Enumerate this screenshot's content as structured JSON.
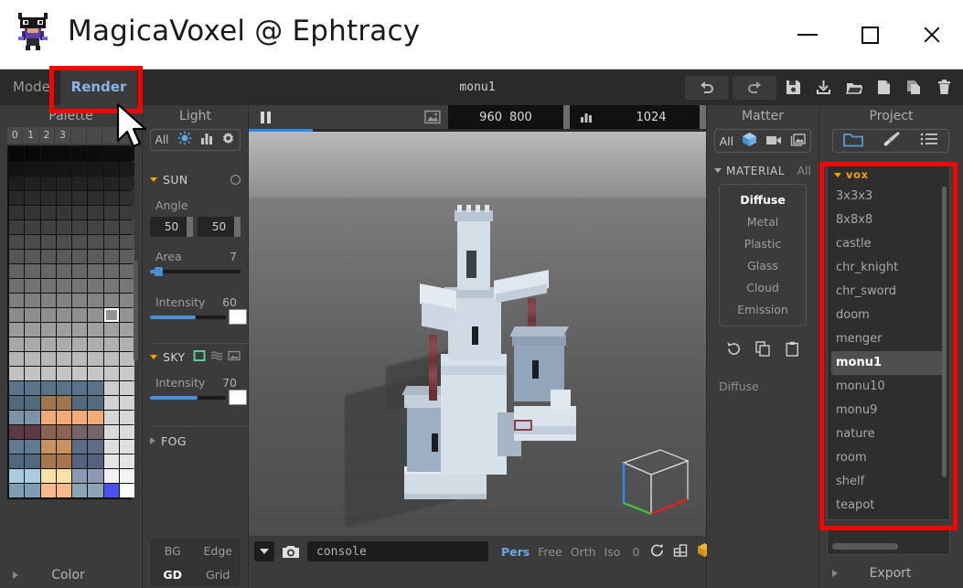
{
  "window": {
    "title": "MagicaVoxel @ Ephtracy",
    "app_icon": "bat-character-icon",
    "controls": {
      "minimize": "minimize-icon",
      "maximize": "maximize-icon",
      "close": "close-icon"
    }
  },
  "menubar": {
    "mode_label": "Mode",
    "render_label": "Render",
    "document_title": "monu1",
    "tools": [
      "undo-icon",
      "redo-icon",
      "save-icon",
      "import-icon",
      "open-folder-icon",
      "new-file-icon",
      "copy-icon",
      "trash-icon"
    ]
  },
  "palette": {
    "title": "Palette",
    "columns": [
      "0",
      "1",
      "2",
      "3"
    ],
    "color_label": "Color",
    "selected_index": 94,
    "swatches": [
      "#070707",
      "#080808",
      "#090909",
      "#0a0a0a",
      "#0b0b0b",
      "#0c0c0c",
      "#0d0d0d",
      "#0e0e0e",
      "#121212",
      "#141414",
      "#151515",
      "#161616",
      "#171717",
      "#181818",
      "#191919",
      "#1a1a1a",
      "#1d1d1d",
      "#1f1f1f",
      "#202020",
      "#212121",
      "#222222",
      "#232323",
      "#242424",
      "#252525",
      "#282828",
      "#2a2a2a",
      "#2b2b2b",
      "#2c2c2c",
      "#2d2d2d",
      "#2e2e2e",
      "#2f2f2f",
      "#303030",
      "#333333",
      "#353535",
      "#363636",
      "#373737",
      "#383838",
      "#393939",
      "#3a3a3a",
      "#3b3b3b",
      "#3e3e3e",
      "#404040",
      "#414141",
      "#424242",
      "#434343",
      "#444444",
      "#454545",
      "#464646",
      "#4a4a4a",
      "#4c4c4c",
      "#4d4d4d",
      "#4e4e4e",
      "#4f4f4f",
      "#505050",
      "#515151",
      "#525252",
      "#565656",
      "#585858",
      "#595959",
      "#5a5a5a",
      "#5b5b5b",
      "#5c5c5c",
      "#5d5d5d",
      "#5e5e5e",
      "#636363",
      "#656565",
      "#666666",
      "#676767",
      "#686868",
      "#696969",
      "#6a6a6a",
      "#6b6b6b",
      "#707070",
      "#727272",
      "#737373",
      "#747474",
      "#757575",
      "#767676",
      "#777777",
      "#787878",
      "#7e7e7e",
      "#808080",
      "#818181",
      "#828282",
      "#838383",
      "#848484",
      "#858585",
      "#868686",
      "#8c8c8c",
      "#8e8e8e",
      "#8f8f8f",
      "#909090",
      "#919191",
      "#929292",
      "#939393",
      "#949494",
      "#9a9a9a",
      "#9c9c9c",
      "#9d9d9d",
      "#9e9e9e",
      "#9f9f9f",
      "#a0a0a0",
      "#a1a1a1",
      "#a2a2a2",
      "#a8a8a8",
      "#aaaaaa",
      "#ababab",
      "#acacac",
      "#adadad",
      "#aeaeae",
      "#b0b0b0",
      "#b1b1b1",
      "#b5b5b5",
      "#b7b7b7",
      "#b8b8b8",
      "#b9b9b9",
      "#bababa",
      "#bbbbbb",
      "#bdbdbd",
      "#bebebe",
      "#c0c0c0",
      "#c2c2c2",
      "#c3c3c3",
      "#c4c4c4",
      "#c5c5c5",
      "#c6c6c6",
      "#c8c8c8",
      "#c9c9c9",
      "#5b7489",
      "#5b7489",
      "#5a7388",
      "#5a7388",
      "#5a7388",
      "#5a7388",
      "#cdcdcd",
      "#cecece",
      "#536a7d",
      "#536a7d",
      "#a0764f",
      "#a0764f",
      "#546b7e",
      "#546b7e",
      "#d2d2d2",
      "#d3d3d3",
      "#7b94a8",
      "#7b94a8",
      "#f0ab78",
      "#f0ab78",
      "#f0ab78",
      "#f0ab78",
      "#d6d6d6",
      "#d7d7d7",
      "#5e3845",
      "#5e3845",
      "#8a6450",
      "#8a6450",
      "#75636b",
      "#75636b",
      "#dadada",
      "#dbdbdb",
      "#5f7a92",
      "#5f7a92",
      "#c99060",
      "#c99060",
      "#5d6b85",
      "#5d6b85",
      "#dedede",
      "#dfdfdf",
      "#4e6880",
      "#4e6880",
      "#a9764c",
      "#a9764c",
      "#566180",
      "#566180",
      "#e4e4e4",
      "#e5e5e5",
      "#a8cbe0",
      "#a8cbe0",
      "#fbe0a8",
      "#fbe0a8",
      "#8b99b3",
      "#8b99b3",
      "#f2f2f2",
      "#f3f3f3",
      "#7e9cb2",
      "#7e9cb2",
      "#fab98a",
      "#fab98a",
      "#8aa3b5",
      "#8aa3b5",
      "#4a53ef",
      "#fbfbfb"
    ]
  },
  "light": {
    "title": "Light",
    "tabs": {
      "all_label": "All",
      "icons": [
        "sun-icon",
        "histogram-icon",
        "gear-icon"
      ]
    },
    "sun": {
      "label": "SUN",
      "toggle_icon": "circle-toggle-icon",
      "angle_label": "Angle",
      "angle_a": "50",
      "angle_b": "50",
      "area_label": "Area",
      "area_value": "7",
      "intensity_label": "Intensity",
      "intensity_value": "60",
      "color": "#ffffff"
    },
    "sky": {
      "label": "SKY",
      "icons": [
        "color-square-icon",
        "gradient-icon",
        "image-icon"
      ],
      "active_color": "#5ec99a",
      "intensity_label": "Intensity",
      "intensity_value": "70",
      "color": "#ffffff"
    },
    "fog": {
      "label": "FOG"
    },
    "display_toggles": {
      "bg": "BG",
      "edge": "Edge",
      "gd": "GD",
      "grid": "Grid",
      "active": "GD"
    }
  },
  "viewport": {
    "render_toolbar": {
      "pause_icon": "pause-icon",
      "image_icon": "image-icon",
      "resolution_w": "960",
      "resolution_h": "800",
      "chart_icon": "histogram-icon",
      "samples": "1024"
    },
    "progress_percent": 14,
    "scene_description": "voxel castle monument render",
    "bottom_bar": {
      "dropdown_icon": "chevron-down-icon",
      "camera_icon": "camera-icon",
      "console_value": "console",
      "console_placeholder": "console",
      "projections": [
        "Pers",
        "Free",
        "Orth",
        "Iso"
      ],
      "active_projection": "Pers",
      "angle_value": "0",
      "icons": [
        "rotate-icon",
        "perspective-grid-icon",
        "box-icon"
      ]
    },
    "gizmo": {
      "axis_x": "#e02020",
      "axis_y": "#2d8cf0",
      "axis_z": "#3fbf3f"
    }
  },
  "matter": {
    "title": "Matter",
    "tabs": {
      "all_label": "All",
      "icons": [
        "cube-icon",
        "video-icon",
        "image-stack-icon"
      ]
    },
    "material_label": "MATERIAL",
    "material_all_label": "All",
    "types": [
      "Diffuse",
      "Metal",
      "Plastic",
      "Glass",
      "Cloud",
      "Emission"
    ],
    "active_type": "Diffuse",
    "actions": [
      "reset-icon",
      "copy-icon",
      "paste-icon"
    ],
    "footer_label": "Diffuse"
  },
  "project": {
    "title": "Project",
    "tabs": {
      "icons": [
        "folder-icon",
        "brush-icon",
        "list-icon"
      ],
      "active": "folder-icon"
    },
    "vox_group_label": "vox",
    "items": [
      "3x3x3",
      "8x8x8",
      "castle",
      "chr_knight",
      "chr_sword",
      "doom",
      "menger",
      "monu1",
      "monu10",
      "monu9",
      "nature",
      "room",
      "shelf",
      "teapot"
    ],
    "selected_item": "monu1",
    "export_label": "Export"
  },
  "annotations": {
    "highlight_color": "#ff0000",
    "regions": [
      "render-tab",
      "vox-project-list"
    ]
  }
}
